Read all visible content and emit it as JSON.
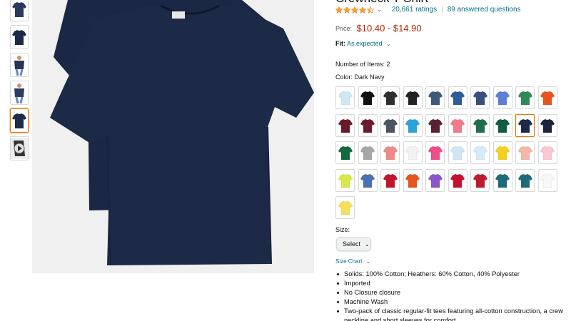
{
  "product": {
    "title": "Crewneck T-Shirt",
    "rating_stars": 4,
    "ratings_text": "20,661 ratings",
    "questions_text": "89 answered questions",
    "price_label": "Price:",
    "price": "$10.40 - $14.90",
    "fit_label": "Fit:",
    "fit_value": "As expected",
    "items_label": "Number of Items:",
    "items_value": "2",
    "color_label": "Color:",
    "color_value": "Dark Navy",
    "size_label": "Size:",
    "size_select": "Select",
    "size_chart": "Size Chart",
    "bullets": [
      "Solids: 100% Cotton; Heathers: 60% Cotton, 40% Polyester",
      "Imported",
      "No Closure closure",
      "Machine Wash",
      "Two-pack of classic regular-fit tees featuring all-cotton construction, a crew neckline and short sleeves for comfort"
    ]
  },
  "colors": {
    "accent_link": "#007185",
    "price_red": "#b12704",
    "star": "#ffa41c",
    "selected_border": "#e77600",
    "shirt_navy": "#1c2a47"
  },
  "thumbnails": [
    {
      "icon": "navy-shirt-thumb",
      "color": "#2a3a5c"
    },
    {
      "icon": "navy-shirt-thumb",
      "color": "#1c2a47"
    },
    {
      "icon": "model-thumb",
      "color": "#243556"
    },
    {
      "icon": "model-full-thumb",
      "color": "#2b3d5e"
    },
    {
      "icon": "folded-shirt-thumb",
      "color": "#1e2c4a"
    },
    {
      "icon": "video-thumb",
      "color": "#222"
    }
  ],
  "swatches": [
    [
      "#cfe9f2",
      "#111111",
      "#2f2f2f",
      "#222222",
      "#3e5a7a",
      "#2f5d9b",
      "#3a4f7d",
      "#5d7fd6",
      "#2e8a57",
      "#e8541b"
    ],
    [
      "#6a1a2a",
      "#6b1b2d",
      "#4a5560",
      "#2aa3d9",
      "#5a2036",
      "#f07b8a",
      "#1f6e4c",
      "#135b43",
      "#1c2a47",
      "#1c2437"
    ],
    [
      "#116b3f",
      "#a6a6a6",
      "#f08a8a",
      "#f2f2f2",
      "#f04b8a",
      "#cfe6f5",
      "#d6eaf7",
      "#f2d21e",
      "#f3b8a8",
      "#f8c9cf"
    ],
    [
      "#d8e84a",
      "#4a6fb5",
      "#c0162b",
      "#e8541b",
      "#8a55c8",
      "#c8102e",
      "#c01a2e",
      "#1f6a7a",
      "#1f6a7a",
      "#f7f7f7"
    ],
    [
      "#f5e05a"
    ]
  ],
  "selected_swatch": [
    1,
    8
  ]
}
